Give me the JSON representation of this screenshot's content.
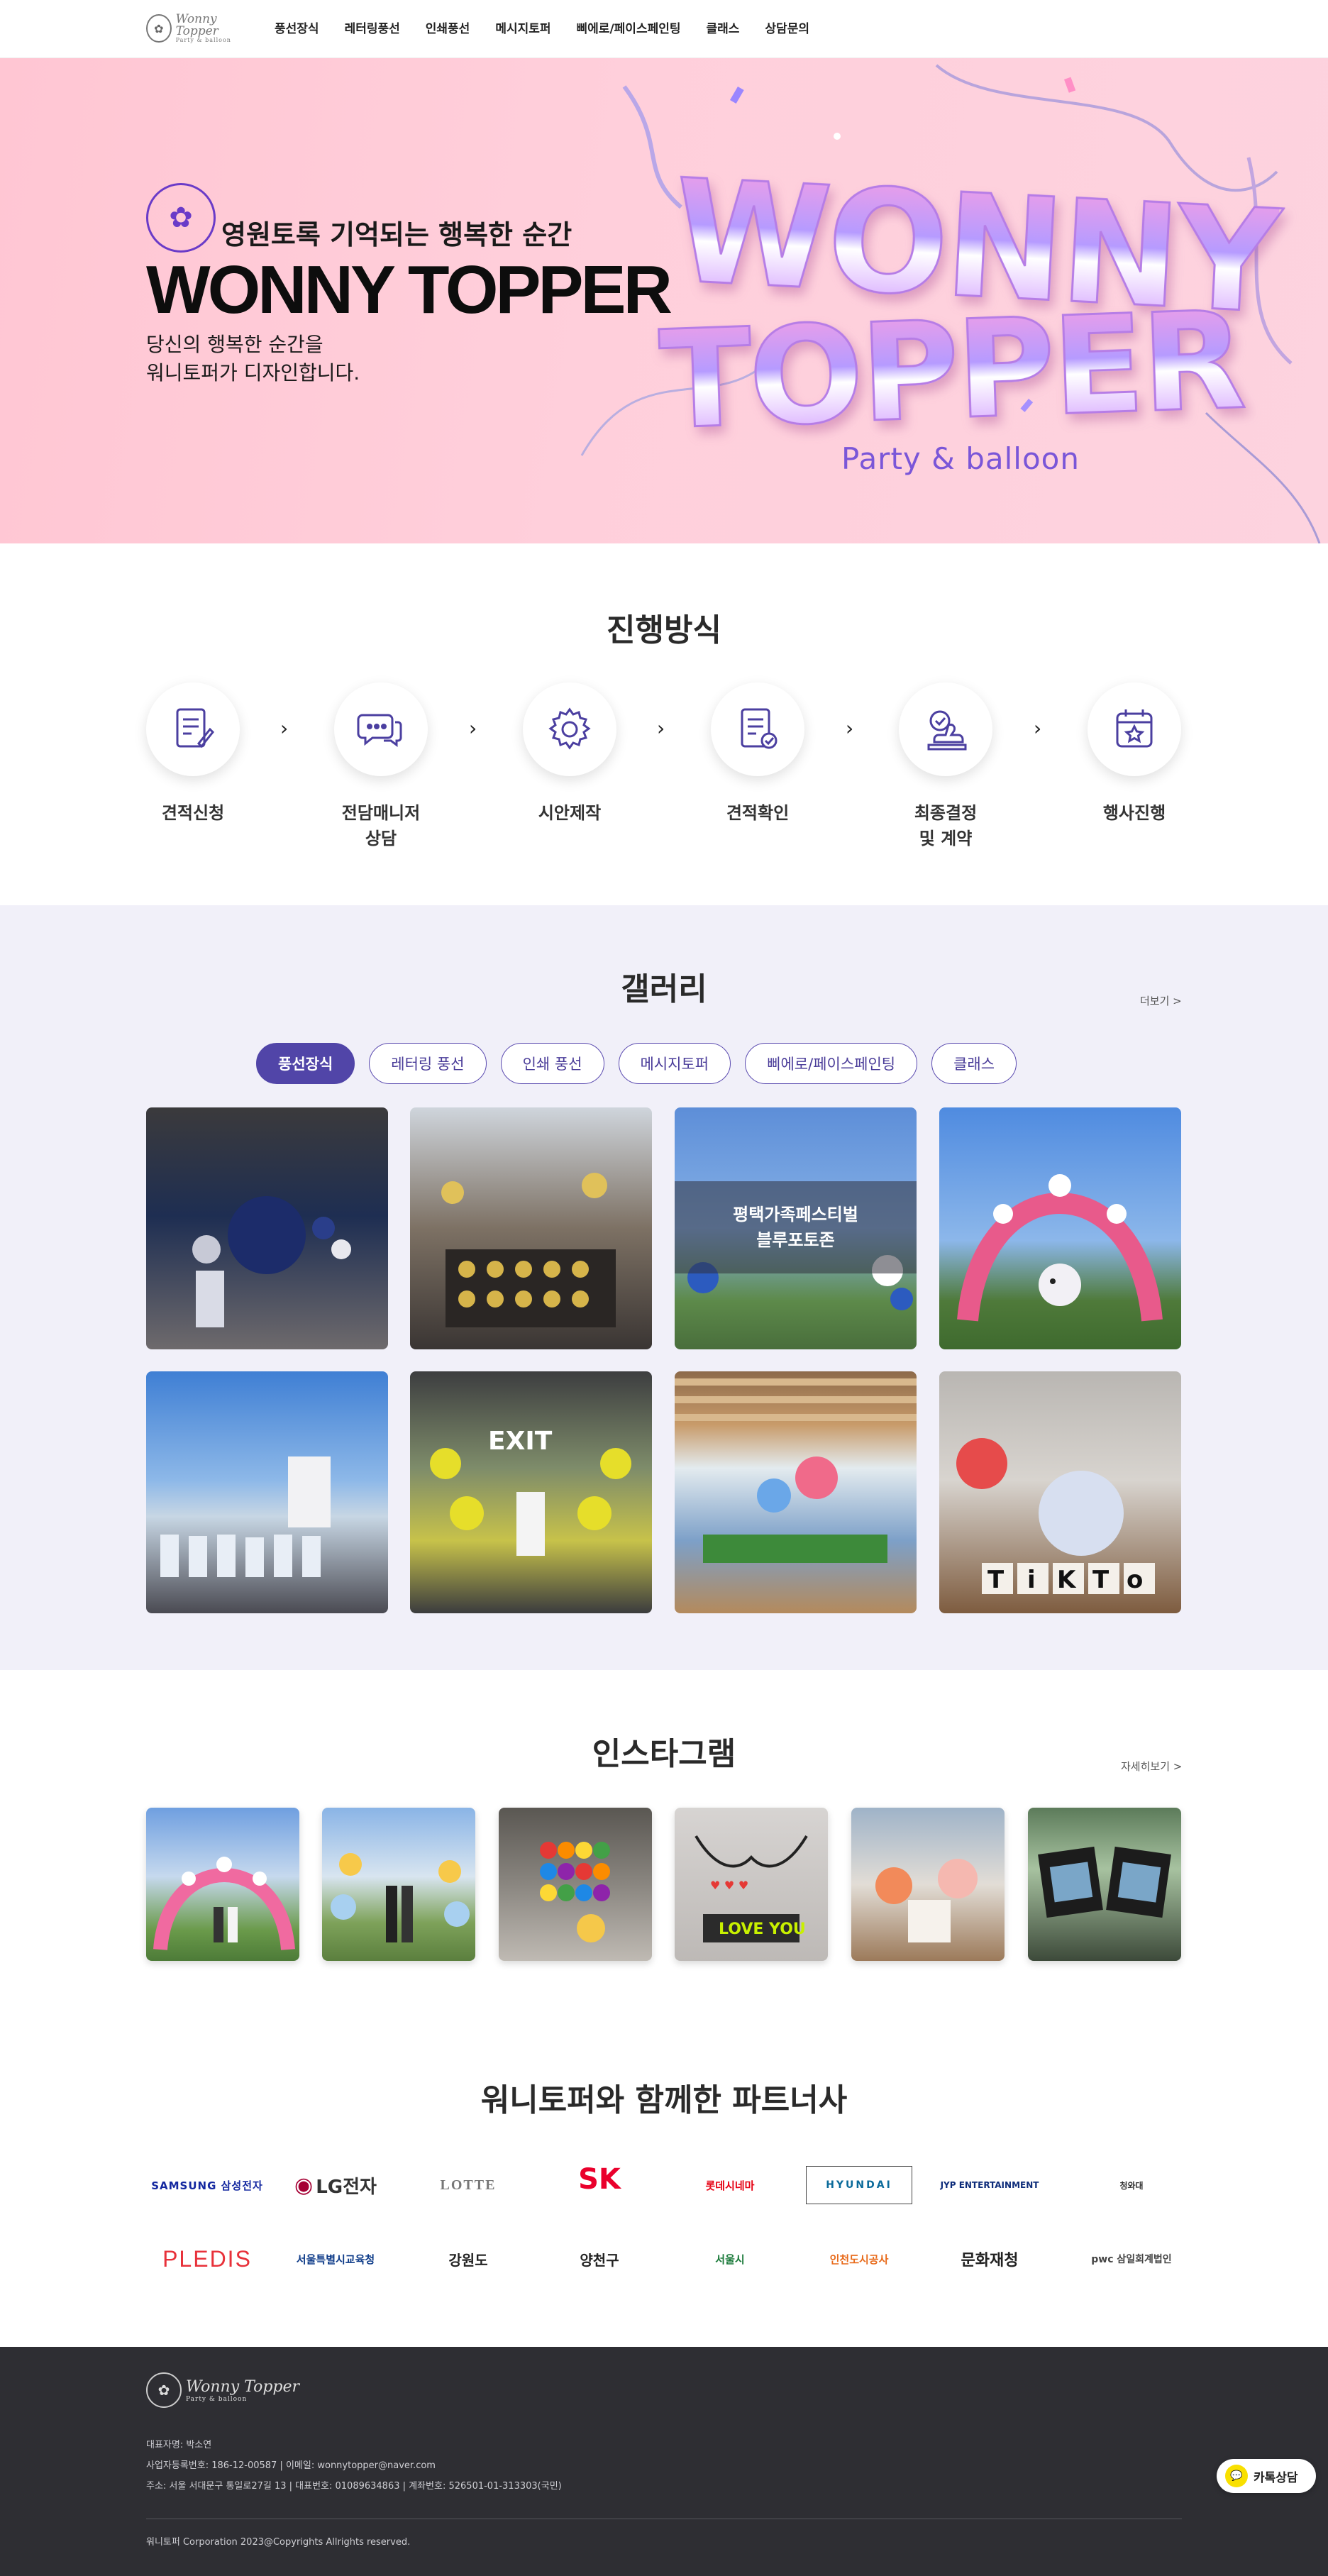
{
  "nav": {
    "logo_text": "Wonny Topper",
    "logo_sub": "Party & balloon",
    "items": [
      {
        "label": "풍선장식"
      },
      {
        "label": "레터링풍선"
      },
      {
        "label": "인쇄풍선"
      },
      {
        "label": "메시지토퍼"
      },
      {
        "label": "삐에로/페이스페인팅"
      },
      {
        "label": "클래스"
      },
      {
        "label": "상담문의"
      }
    ]
  },
  "hero": {
    "subtitle": "영원토록 기억되는 행복한 순간",
    "title": "WONNY TOPPER",
    "description": "당신의 행복한 순간을\n워니토퍼가 디자인합니다.",
    "big_line1": "WONNY",
    "big_line2": "TOPPER",
    "tagline": "Party & balloon",
    "colors": {
      "bg": "#ffc9d6",
      "accent": "#6a3bc8"
    }
  },
  "process": {
    "title": "진행방식",
    "steps": [
      {
        "label": "견적신청",
        "icon": "quote-form-icon"
      },
      {
        "label": "전담매니저\n상담",
        "icon": "chat-bubble-icon"
      },
      {
        "label": "시안제작",
        "icon": "gear-icon"
      },
      {
        "label": "견적확인",
        "icon": "document-check-icon"
      },
      {
        "label": "최종결정\n및 계약",
        "icon": "stamp-icon"
      },
      {
        "label": "행사진행",
        "icon": "calendar-star-icon"
      }
    ]
  },
  "gallery": {
    "title": "갤러리",
    "more": "더보기 >",
    "tabs": [
      {
        "label": "풍선장식",
        "active": true
      },
      {
        "label": "레터링 풍선"
      },
      {
        "label": "인쇄 풍선"
      },
      {
        "label": "메시지토퍼"
      },
      {
        "label": "삐에로/페이스페인팅"
      },
      {
        "label": "클래스"
      }
    ],
    "overlay_text": "평택가족페스티벌\n블루포토존"
  },
  "instagram": {
    "title": "인스타그램",
    "more": "자세히보기 >"
  },
  "partners": {
    "title": "워니토퍼와 함께한 파트너사",
    "row1": [
      "SAMSUNG 삼성전자",
      "LG전자",
      "LOTTE",
      "SK",
      "롯데시네마",
      "HYUNDAI",
      "JYP ENTERTAINMENT",
      "청와대"
    ],
    "row2": [
      "PLEDIS",
      "서울특별시교육청",
      "강원도",
      "양천구",
      "서울시",
      "인천도시공사",
      "문화재청",
      "pwc 삼일회계법인"
    ]
  },
  "footer": {
    "logo_text": "Wonny Topper",
    "logo_sub": "Party & balloon",
    "ceo": "대표자명: 박소연",
    "biz": "사업자등록번호: 186-12-00587  |  이메일: wonnytopper@naver.com",
    "addr": "주소: 서울 서대문구 통일로27길 13  |  대표번호: 01089634863  |  계좌번호: 526501-01-313303(국민)",
    "copyright": "워니토퍼 Corporation 2023@Copyrights Allrights reserved."
  },
  "kakao": {
    "label": "카톡상담"
  }
}
